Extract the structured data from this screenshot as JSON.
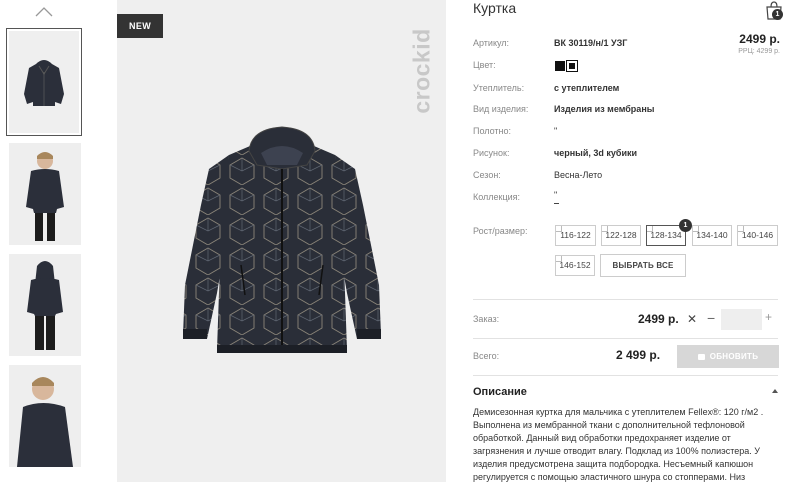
{
  "badge": "NEW",
  "brand": "crockid",
  "product": {
    "title": "Куртка",
    "price": "2499 р.",
    "rrp": "РРЦ: 4299 р."
  },
  "cart": {
    "count": "1"
  },
  "attributes": [
    {
      "label": "Артикул:",
      "value": "ВК 30119/н/1 УЗГ"
    },
    {
      "label": "Цвет:",
      "value": ""
    },
    {
      "label": "Утеплитель:",
      "value": "с утеплителем"
    },
    {
      "label": "Вид изделия:",
      "value": "Изделия из мембраны"
    },
    {
      "label": "Полотно:",
      "value": "\""
    },
    {
      "label": "Рисунок:",
      "value": "черный, 3d кубики"
    },
    {
      "label": "Сезон:",
      "value": "Весна-Лето"
    },
    {
      "label": "Коллекция:",
      "value": "\""
    }
  ],
  "colors": [
    "#111111",
    "#111111"
  ],
  "sizes": {
    "label": "Рост/размер:",
    "options": [
      "116-122",
      "122-128",
      "128-134",
      "134-140",
      "140-146",
      "146-152"
    ],
    "selected": "128-134",
    "selected_count": "1",
    "select_all": "ВЫБРАТЬ ВСЕ"
  },
  "order": {
    "label": "Заказ:",
    "price": "2499 р.",
    "remove": "✕",
    "minus": "−",
    "plus": "+",
    "quantity": ""
  },
  "total": {
    "label": "Всего:",
    "price": "2 499 р.",
    "update_button": "ОБНОВИТЬ"
  },
  "description": {
    "title": "Описание",
    "text": "Демисезонная куртка для мальчика с утеплителем Fellex®: 120 г/м2 . Выполнена из мембранной ткани с дополнительной тефлоновой обработкой. Данный вид обработки предохраняет изделие от загрязнения и лучше отводит влагу. Подклад из 100% полиэстера. У изделия предусмотрена защита подбородка. Несъемный капюшон регулируется с помощью эластичного шнура со стопперами. Низ"
  },
  "icons": {
    "thumbs_up": "chevron-up-icon",
    "cart": "shopping-bag-icon",
    "collapse": "chevron-up-icon"
  }
}
